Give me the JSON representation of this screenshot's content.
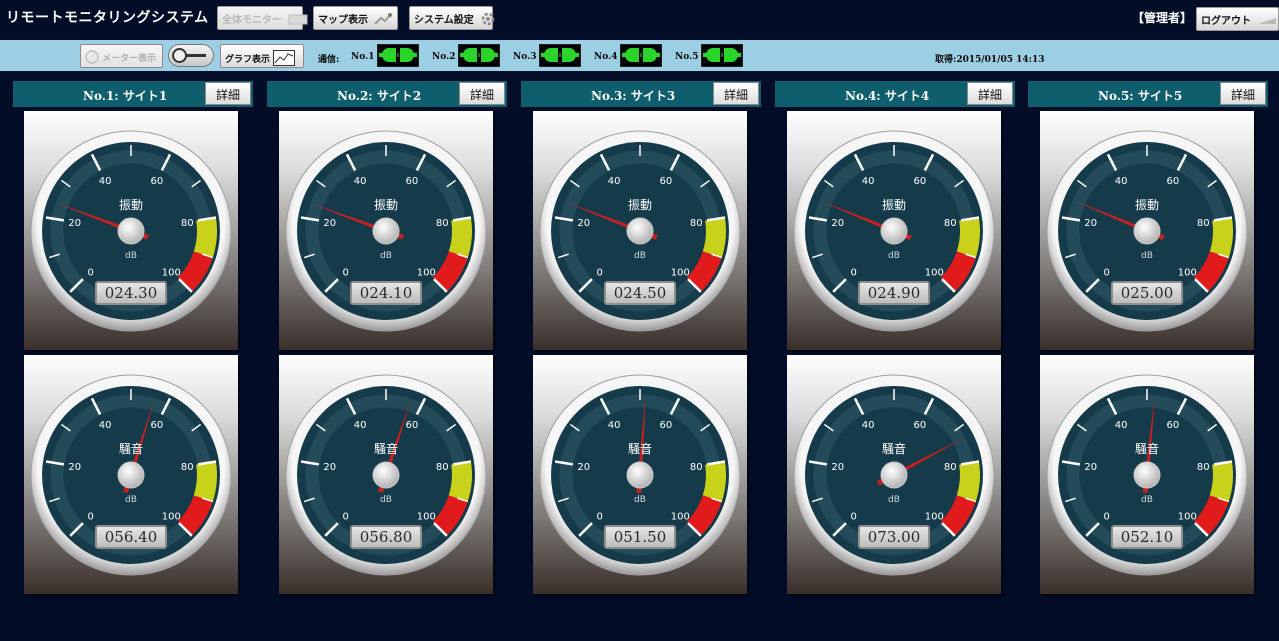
{
  "header": {
    "title": "リモートモニタリングシステム",
    "buttons": {
      "overview": "全体モニター",
      "map": "マップ表示",
      "settings": "システム設定"
    },
    "admin_label": "【管理者】",
    "logout": "ログアウト"
  },
  "toolbar": {
    "meter_view": "メーター表示",
    "graph_view": "グラフ表示",
    "comm_label": "通信:",
    "connections": [
      {
        "label": "No.1"
      },
      {
        "label": "No.2"
      },
      {
        "label": "No.3"
      },
      {
        "label": "No.4"
      },
      {
        "label": "No.5"
      }
    ],
    "acquired": "取得:2015/01/05 14:13"
  },
  "gauge_common": {
    "tick_labels": [
      "0",
      "20",
      "40",
      "60",
      "80",
      "100"
    ],
    "unit": "dB",
    "min": 0,
    "max": 100,
    "yellow_zone": [
      80,
      90
    ],
    "red_zone": [
      90,
      100
    ],
    "colors": {
      "dial": "#153b4a",
      "yellow": "#c8d21a",
      "red": "#e11b1b",
      "needle": "#c82020"
    }
  },
  "sites": [
    {
      "title": "No.1: サイト1",
      "detail": "詳細",
      "vibration": {
        "label": "振動",
        "value": 24.3,
        "display": "024.30"
      },
      "noise": {
        "label": "騒音",
        "value": 56.4,
        "display": "056.40"
      }
    },
    {
      "title": "No.2: サイト2",
      "detail": "詳細",
      "vibration": {
        "label": "振動",
        "value": 24.1,
        "display": "024.10"
      },
      "noise": {
        "label": "騒音",
        "value": 56.8,
        "display": "056.80"
      }
    },
    {
      "title": "No.3: サイト3",
      "detail": "詳細",
      "vibration": {
        "label": "振動",
        "value": 24.5,
        "display": "024.50"
      },
      "noise": {
        "label": "騒音",
        "value": 51.5,
        "display": "051.50"
      }
    },
    {
      "title": "No.4: サイト4",
      "detail": "詳細",
      "vibration": {
        "label": "振動",
        "value": 24.9,
        "display": "024.90"
      },
      "noise": {
        "label": "騒音",
        "value": 73.0,
        "display": "073.00"
      }
    },
    {
      "title": "No.5: サイト5",
      "detail": "詳細",
      "vibration": {
        "label": "振動",
        "value": 25.0,
        "display": "025.00"
      },
      "noise": {
        "label": "騒音",
        "value": 52.1,
        "display": "052.10"
      }
    }
  ]
}
